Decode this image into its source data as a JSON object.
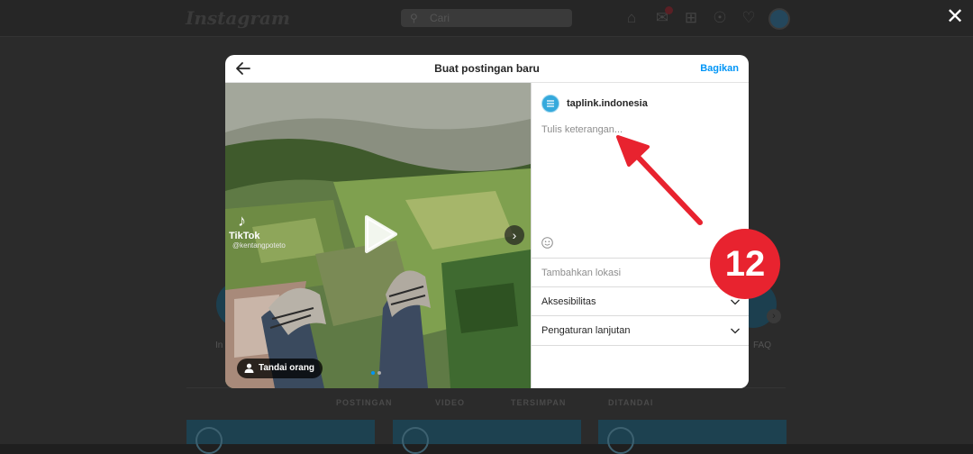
{
  "background": {
    "logo": "Instagram",
    "search_placeholder": "Cari",
    "close_icon": "close-icon",
    "profile_partial_left": "In",
    "profile_partial_right": "FAQ",
    "tabs": [
      "POSTINGAN",
      "VIDEO",
      "TERSIMPAN",
      "DITANDAI"
    ]
  },
  "modal": {
    "title": "Buat postingan baru",
    "share_label": "Bagikan",
    "back_icon": "arrow-left-icon"
  },
  "media": {
    "tiktok_label": "TikTok",
    "tiktok_user": "@kentangpoteto",
    "tag_people_label": "Tandai orang",
    "play_icon": "play-icon",
    "next_icon": "chevron-right-icon",
    "carousel_dots": 2,
    "carousel_active": 0
  },
  "panel": {
    "account_name": "taplink.indonesia",
    "caption_placeholder": "Tulis keterangan...",
    "emoji_icon": "smile-icon",
    "location_placeholder": "Tambahkan lokasi",
    "accessibility_label": "Aksesibilitas",
    "advanced_label": "Pengaturan lanjutan"
  },
  "annotation": {
    "step_number": "12",
    "color": "#e8232f"
  }
}
